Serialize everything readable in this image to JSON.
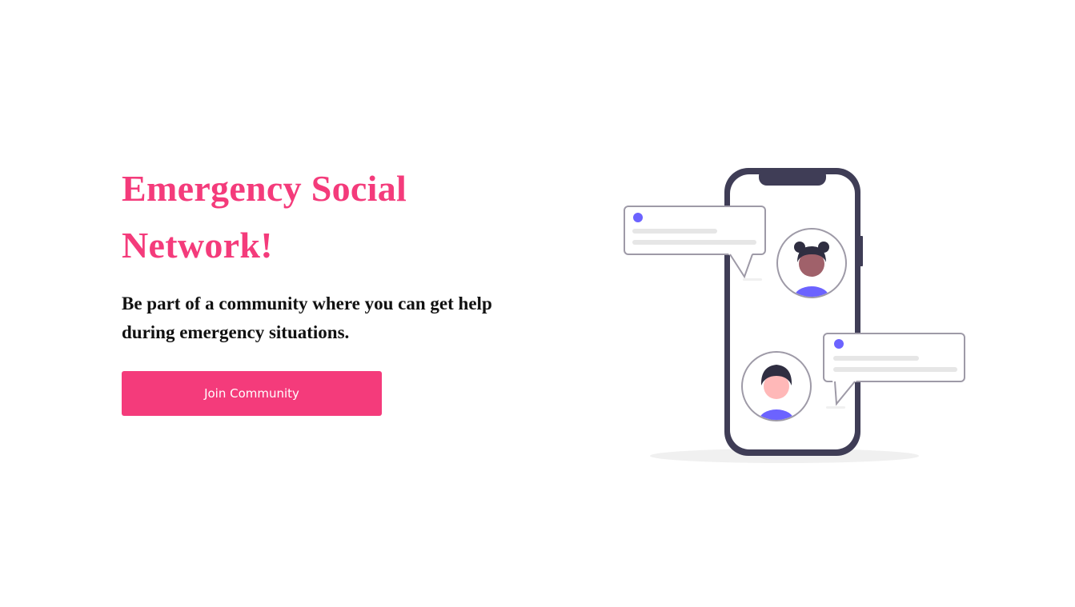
{
  "hero": {
    "title": "Emergency Social Network!",
    "subtitle": "Be part of a community where you can get help during emergency situations.",
    "cta_label": "Join Community"
  },
  "illustration": {
    "icon": "phone-chat-illustration"
  },
  "colors": {
    "accent": "#f43b7b",
    "text": "#111111",
    "phone_frame": "#3f3d56",
    "avatar_accent": "#6c63ff"
  }
}
